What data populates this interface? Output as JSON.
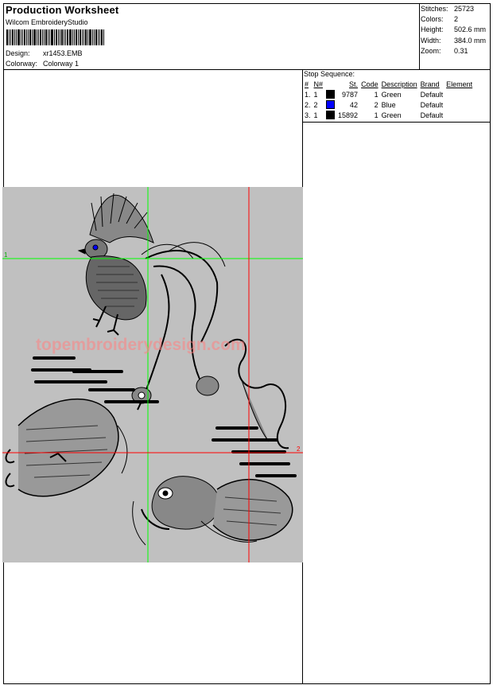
{
  "header": {
    "title": "Production Worksheet",
    "software": "Wilcom EmbroideryStudio",
    "design_label": "Design:",
    "design_value": "xr1453.EMB",
    "colorway_label": "Colorway:",
    "colorway_value": "Colorway 1"
  },
  "stats": [
    {
      "label": "Stitches:",
      "value": "25723"
    },
    {
      "label": "Colors:",
      "value": "2"
    },
    {
      "label": "Height:",
      "value": "502.6 mm"
    },
    {
      "label": "Width:",
      "value": "384.0 mm"
    },
    {
      "label": "Zoom:",
      "value": "0.31"
    }
  ],
  "stop_sequence": {
    "title": "Stop Sequence:",
    "columns": {
      "num": "#",
      "n": "N#",
      "st": "St.",
      "code": "Code",
      "description": "Description",
      "brand": "Brand",
      "element": "Element"
    },
    "rows": [
      {
        "num": "1.",
        "n": "1",
        "color": "#000000",
        "st": "9787",
        "code": "1",
        "description": "Green",
        "brand": "Default",
        "element": ""
      },
      {
        "num": "2.",
        "n": "2",
        "color": "#0000ff",
        "st": "42",
        "code": "2",
        "description": "Blue",
        "brand": "Default",
        "element": ""
      },
      {
        "num": "3.",
        "n": "1",
        "color": "#000000",
        "st": "15892",
        "code": "1",
        "description": "Green",
        "brand": "Default",
        "element": ""
      }
    ]
  },
  "preview": {
    "watermark": "topembroiderydesign.com",
    "marker_1": "1",
    "marker_2": "2",
    "colors": {
      "background": "#c0c0c0",
      "green_guide": "#00ff00",
      "red_guide": "#ff0000",
      "stitch": "#000000",
      "eye": "#0000ff",
      "watermark": "#ff8080"
    }
  }
}
